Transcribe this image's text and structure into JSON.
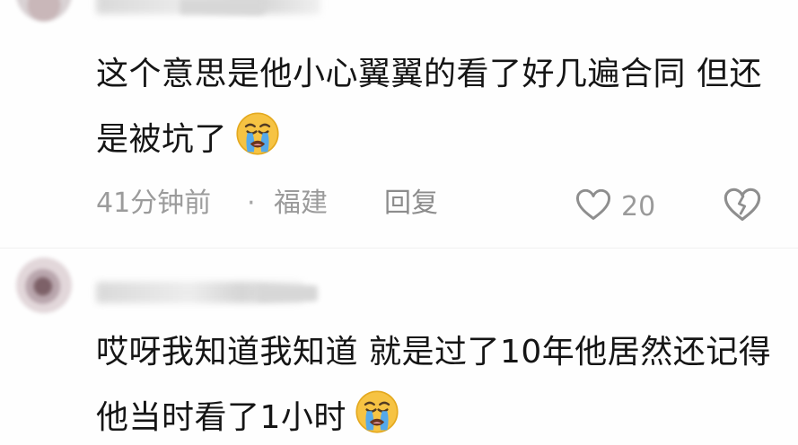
{
  "comments": [
    {
      "text": "这个意思是他小心翼翼的看了好几遍合同 但还是被坑了",
      "emoji": "crying-face",
      "time": "41分钟前",
      "location": "福建",
      "separator": "·",
      "reply_label": "回复",
      "likes": "20",
      "like_icon": "heart-outline-icon",
      "dislike_icon": "broken-heart-icon"
    },
    {
      "text": "哎呀我知道我知道 就是过了10年他居然还记得他当时看了1小时",
      "emoji": "crying-face"
    }
  ],
  "colors": {
    "text": "#151515",
    "meta": "#9b9b9b",
    "emoji_face": "#f6c343",
    "emoji_tears": "#55a9ea"
  }
}
